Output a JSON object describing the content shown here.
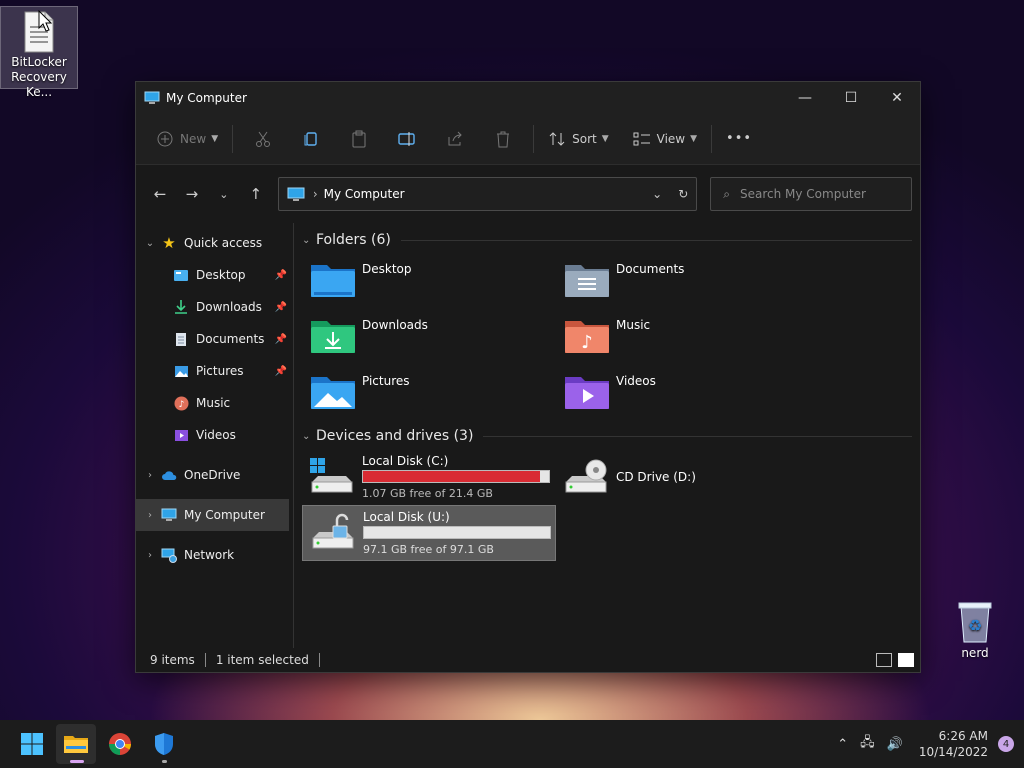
{
  "desktop": {
    "icons": [
      {
        "label_line1": "BitLocker",
        "label_line2": "Recovery Ke...",
        "icon": "text-file-icon"
      },
      {
        "label_line1": "nerd",
        "label_line2": "",
        "icon": "recycle-bin-icon"
      }
    ]
  },
  "window": {
    "title": "My Computer",
    "controls": {
      "minimize": "—",
      "maximize": "☐",
      "close": "✕"
    }
  },
  "commandbar": {
    "new_label": "New",
    "sort_label": "Sort",
    "view_label": "View",
    "more_label": "•••"
  },
  "address": {
    "breadcrumb": "My Computer",
    "search_placeholder": "Search My Computer"
  },
  "navpane": {
    "quick_access": "Quick access",
    "items": [
      {
        "label": "Desktop",
        "pinned": true
      },
      {
        "label": "Downloads",
        "pinned": true
      },
      {
        "label": "Documents",
        "pinned": true
      },
      {
        "label": "Pictures",
        "pinned": true
      },
      {
        "label": "Music",
        "pinned": false
      },
      {
        "label": "Videos",
        "pinned": false
      }
    ],
    "onedrive": "OneDrive",
    "mycomputer": "My Computer",
    "network": "Network"
  },
  "folders": {
    "header": "Folders (6)",
    "items": [
      "Desktop",
      "Documents",
      "Downloads",
      "Music",
      "Pictures",
      "Videos"
    ]
  },
  "drives": {
    "header": "Devices and drives (3)",
    "items": [
      {
        "name": "Local Disk (C:)",
        "free": "1.07 GB free of 21.4 GB",
        "used_fraction": 0.95,
        "bar_color": "#d92b33"
      },
      {
        "name": "CD Drive (D:)"
      },
      {
        "name": "Local Disk (U:)",
        "free": "97.1 GB free of 97.1 GB",
        "used_fraction": 0.0,
        "bar_color": "#2a7fd4"
      }
    ]
  },
  "status": {
    "items": "9 items",
    "selected": "1 item selected"
  },
  "taskbar": {
    "clock_time": "6:26 AM",
    "clock_date": "10/14/2022",
    "notification_count": "4"
  }
}
